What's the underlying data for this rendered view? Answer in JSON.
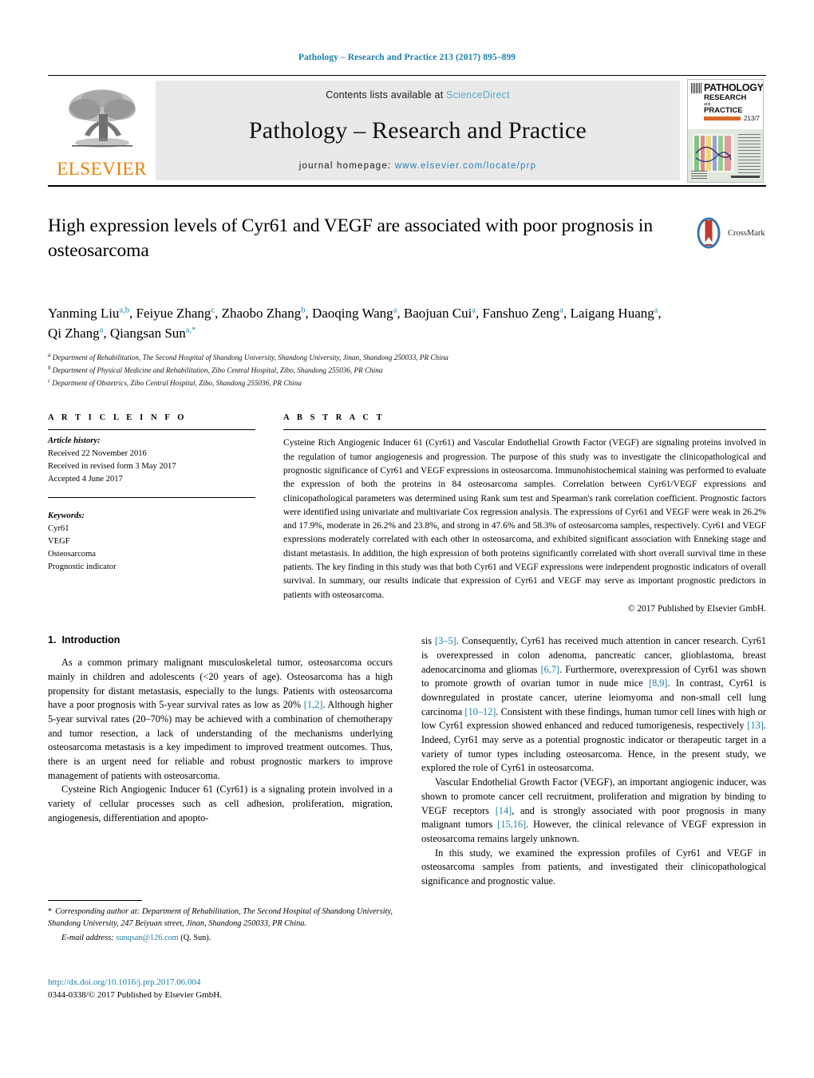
{
  "running_head": "Pathology – Research and Practice 213 (2017) 895–899",
  "masthead": {
    "publisher_name": "ELSEVIER",
    "contents_prefix": "Contents lists available at ",
    "contents_link": "ScienceDirect",
    "journal_name": "Pathology – Research and Practice",
    "homepage_prefix": "journal homepage: ",
    "homepage_url": "www.elsevier.com/locate/prp",
    "cover": {
      "line1": "PATHOLOGY",
      "line2": "RESEARCH",
      "line3": "and",
      "line4": "PRACTICE",
      "volume": "213/7",
      "imprint": "Original papers and reviews on experimental and clinical aspects of human body, of biology"
    }
  },
  "article": {
    "title": "High expression levels of Cyr61 and VEGF are associated with poor prognosis in osteosarcoma",
    "crossmark_label": "CrossMark",
    "authors_line1": "Yanming Liu",
    "authors": [
      {
        "name": "Yanming Liu",
        "sup": "a,b"
      },
      {
        "name": "Feiyue Zhang",
        "sup": "c"
      },
      {
        "name": "Zhaobo Zhang",
        "sup": "b"
      },
      {
        "name": "Daoqing Wang",
        "sup": "a"
      },
      {
        "name": "Baojuan Cui",
        "sup": "a"
      },
      {
        "name": "Fanshuo Zeng",
        "sup": "a"
      },
      {
        "name": "Laigang Huang",
        "sup": "a"
      },
      {
        "name": "Qi Zhang",
        "sup": "a"
      },
      {
        "name": "Qiangsan Sun",
        "sup": "a,*"
      }
    ],
    "affiliations": [
      {
        "marker": "a",
        "text": "Department of Rehabilitation, The Second Hospital of Shandong University, Shandong University, Jinan, Shandong 250033, PR China"
      },
      {
        "marker": "b",
        "text": "Department of Physical Medicine and Rehabilitation, Zibo Central Hospital, Zibo, Shandong 255036, PR China"
      },
      {
        "marker": "c",
        "text": "Department of Obstetrics, Zibo Central Hospital, Zibo, Shandong 255036, PR China"
      }
    ]
  },
  "article_info": {
    "heading": "A R T I C L E   I N F O",
    "history_label": "Article history:",
    "history": [
      "Received 22 November 2016",
      "Received in revised form 3 May 2017",
      "Accepted 4 June 2017"
    ],
    "keywords_label": "Keywords:",
    "keywords": [
      "Cyr61",
      "VEGF",
      "Osteosarcoma",
      "Prognostic indicator"
    ]
  },
  "abstract": {
    "heading": "A B S T R A C T",
    "text": "Cysteine Rich Angiogenic Inducer 61 (Cyr61) and Vascular Endothelial Growth Factor (VEGF) are signaling proteins involved in the regulation of tumor angiogenesis and progression. The purpose of this study was to investigate the clinicopathological and prognostic significance of Cyr61 and VEGF expressions in osteosarcoma. Immunohistochemical staining was performed to evaluate the expression of both the proteins in 84 osteosarcoma samples. Correlation between Cyr61/VEGF expressions and clinicopathological parameters was determined using Rank sum test and Spearman's rank correlation coefficient. Prognostic factors were identified using univariate and multivariate Cox regression analysis. The expressions of Cyr61 and VEGF were weak in 26.2% and 17.9%, moderate in 26.2% and 23.8%, and strong in 47.6% and 58.3% of osteosarcoma samples, respectively. Cyr61 and VEGF expressions moderately correlated with each other in osteosarcoma, and exhibited significant association with Enneking stage and distant metastasis. In addition, the high expression of both proteins significantly correlated with short overall survival time in these patients. The key finding in this study was that both Cyr61 and VEGF expressions were independent prognostic indicators of overall survival. In summary, our results indicate that expression of Cyr61 and VEGF may serve as important prognostic predictors in patients with osteosarcoma.",
    "copyright": "© 2017 Published by Elsevier GmbH."
  },
  "introduction": {
    "number": "1.",
    "title": "Introduction",
    "left_paragraphs": [
      "As a common primary malignant musculoskeletal tumor, osteosarcoma occurs mainly in children and adolescents (<20 years of age). Osteosarcoma has a high propensity for distant metastasis, especially to the lungs. Patients with osteosarcoma have a poor prognosis with 5-year survival rates as low as 20% [1,2]. Although higher 5-year survival rates (20–70%) may be achieved with a combination of chemotherapy and tumor resection, a lack of understanding of the mechanisms underlying osteosarcoma metastasis is a key impediment to improved treatment outcomes. Thus, there is an urgent need for reliable and robust prognostic markers to improve management of patients with osteosarcoma.",
      "Cysteine Rich Angiogenic Inducer 61 (Cyr61) is a signaling protein involved in a variety of cellular processes such as cell adhesion, proliferation, migration, angiogenesis, differentiation and apopto-"
    ],
    "right_paragraphs": [
      "sis [3–5]. Consequently, Cyr61 has received much attention in cancer research. Cyr61 is overexpressed in colon adenoma, pancreatic cancer, glioblastoma, breast adenocarcinoma and gliomas [6,7]. Furthermore, overexpression of Cyr61 was shown to promote growth of ovarian tumor in nude mice [8,9]. In contrast, Cyr61 is downregulated in prostate cancer, uterine leiomyoma and non-small cell lung carcinoma [10–12]. Consistent with these findings, human tumor cell lines with high or low Cyr61 expression showed enhanced and reduced tumorigenesis, respectively [13]. Indeed, Cyr61 may serve as a potential prognostic indicator or therapeutic target in a variety of tumor types including osteosarcoma. Hence, in the present study, we explored the role of Cyr61 in osteosarcoma.",
      "Vascular Endothelial Growth Factor (VEGF), an important angiogenic inducer, was shown to promote cancer cell recruitment, proliferation and migration by binding to VEGF receptors [14], and is strongly associated with poor prognosis in many malignant tumors [15,16]. However, the clinical relevance of VEGF expression in osteosarcoma remains largely unknown.",
      "In this study, we examined the expression profiles of Cyr61 and VEGF in osteosarcoma samples from patients, and investigated their clinicopathological significance and prognostic value."
    ]
  },
  "footnotes": {
    "corresponding_marker": "*",
    "corresponding_text": "Corresponding author at: Department of Rehabilitation, The Second Hospital of Shandong University, Shandong University, 247 Beiyuan street, Jinan, Shandong 250033, PR China.",
    "email_label": "E-mail address:",
    "email": "sunqsan@126.com",
    "email_owner": "(Q. Sun).",
    "doi": "http://dx.doi.org/10.1016/j.prp.2017.06.004",
    "issn_line": "0344-0338/© 2017 Published by Elsevier GmbH."
  },
  "colors": {
    "link_blue": "#1b7fa8",
    "sciencedirect_blue": "#5ba8d0",
    "elsevier_orange": "#f07d00",
    "masthead_grey": "#e9e9e9"
  }
}
